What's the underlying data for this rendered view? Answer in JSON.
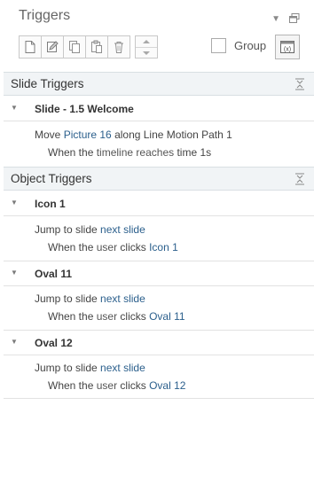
{
  "panel": {
    "title": "Triggers"
  },
  "toolbar": {
    "group_label": "Group"
  },
  "slide_triggers": {
    "header": "Slide Triggers",
    "slide_name": "Slide - 1.5 Welcome",
    "trigger": {
      "action": "Move",
      "object": "Picture 16",
      "along": "along Line Motion Path 1",
      "when": "When the",
      "subject": "timeline",
      "event": "reaches",
      "time_text": "time 1s"
    }
  },
  "object_triggers": {
    "header": "Object Triggers",
    "items": [
      {
        "name": "Icon 1",
        "action": "Jump to slide",
        "target": "next slide",
        "when": "When the",
        "user": "user",
        "event": "clicks",
        "object": "Icon 1"
      },
      {
        "name": "Oval 11",
        "action": "Jump to slide",
        "target": "next slide",
        "when": "When the",
        "user": "user",
        "event": "clicks",
        "object": "Oval 11"
      },
      {
        "name": "Oval 12",
        "action": "Jump to slide",
        "target": "next slide",
        "when": "When the",
        "user": "user",
        "event": "clicks",
        "object": "Oval 12"
      }
    ]
  }
}
